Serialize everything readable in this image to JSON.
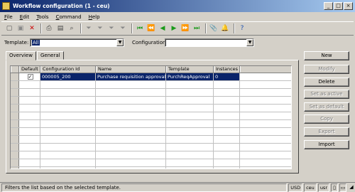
{
  "window": {
    "title": "Workflow configuration (1 - ceu)"
  },
  "menu": [
    "File",
    "Edit",
    "Tools",
    "Command",
    "Help"
  ],
  "toolbar": {
    "icons": [
      "new-icon",
      "save-icon",
      "delete-icon",
      "print-icon",
      "print-preview-icon",
      "find-icon",
      "filter-icon",
      "filter-by-selection-icon",
      "advanced-filter-icon",
      "remove-filter-icon",
      "first-icon",
      "previous-page-icon",
      "previous-icon",
      "next-icon",
      "next-page-icon",
      "last-icon",
      "document-handling-icon",
      "alert-icon",
      "help-icon"
    ]
  },
  "filter": {
    "template_label": "Template:",
    "template_value": "All",
    "configuration_label": "Configuration:",
    "configuration_value": ""
  },
  "tabs": [
    "Overview",
    "General"
  ],
  "grid": {
    "columns": [
      "Default",
      "Configuration Id",
      "Name",
      "Template",
      "Instances"
    ],
    "rows": [
      {
        "default": true,
        "config_id": "000005_200",
        "name": "Purchase requisition approval",
        "template": "PurchReqApproval",
        "instances": "0"
      }
    ]
  },
  "buttons": {
    "new": "New",
    "modify": "Modify",
    "delete": "Delete",
    "set_active": "Set as active",
    "set_default": "Set as default",
    "copy": "Copy",
    "export": "Export",
    "import": "Import"
  },
  "status": {
    "text": "Filters the list based on the selected template.",
    "currency": "USD",
    "company": "ceu",
    "user": "usr"
  }
}
